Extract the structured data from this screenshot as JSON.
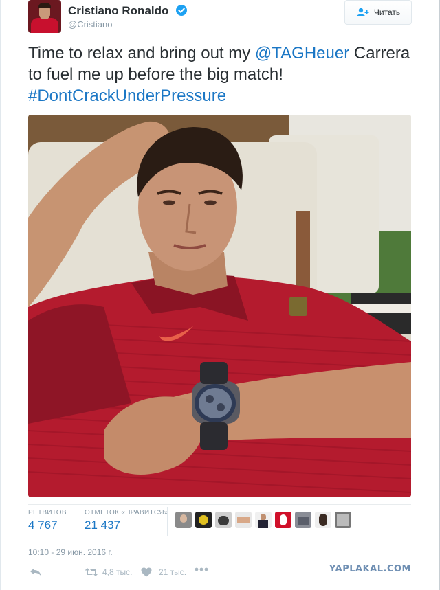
{
  "header": {
    "name": "Cristiano Ronaldo",
    "handle": "@Cristiano",
    "follow_label": "Читать"
  },
  "tweet": {
    "text_part1": "Time to relax and bring out my ",
    "mention": "@TAGHeuer",
    "text_part2": " Carrera to fuel me up before the big match!",
    "hashtag": "#DontCrackUnderPressure"
  },
  "stats": {
    "retweets_label": "РЕТВИТОВ",
    "retweets_value": "4 767",
    "likes_label": "ОТМЕТОК «НРАВИТСЯ»",
    "likes_value": "21 437"
  },
  "timestamp": "10:10 - 29 июн. 2016 г.",
  "actions": {
    "retweet_count": "4,8 тыс.",
    "like_count": "21 тыс."
  },
  "watermark": "YAPLAKAL.COM",
  "colors": {
    "link": "#1b77c5",
    "verified": "#1da1f2",
    "muted": "#8899a6"
  }
}
